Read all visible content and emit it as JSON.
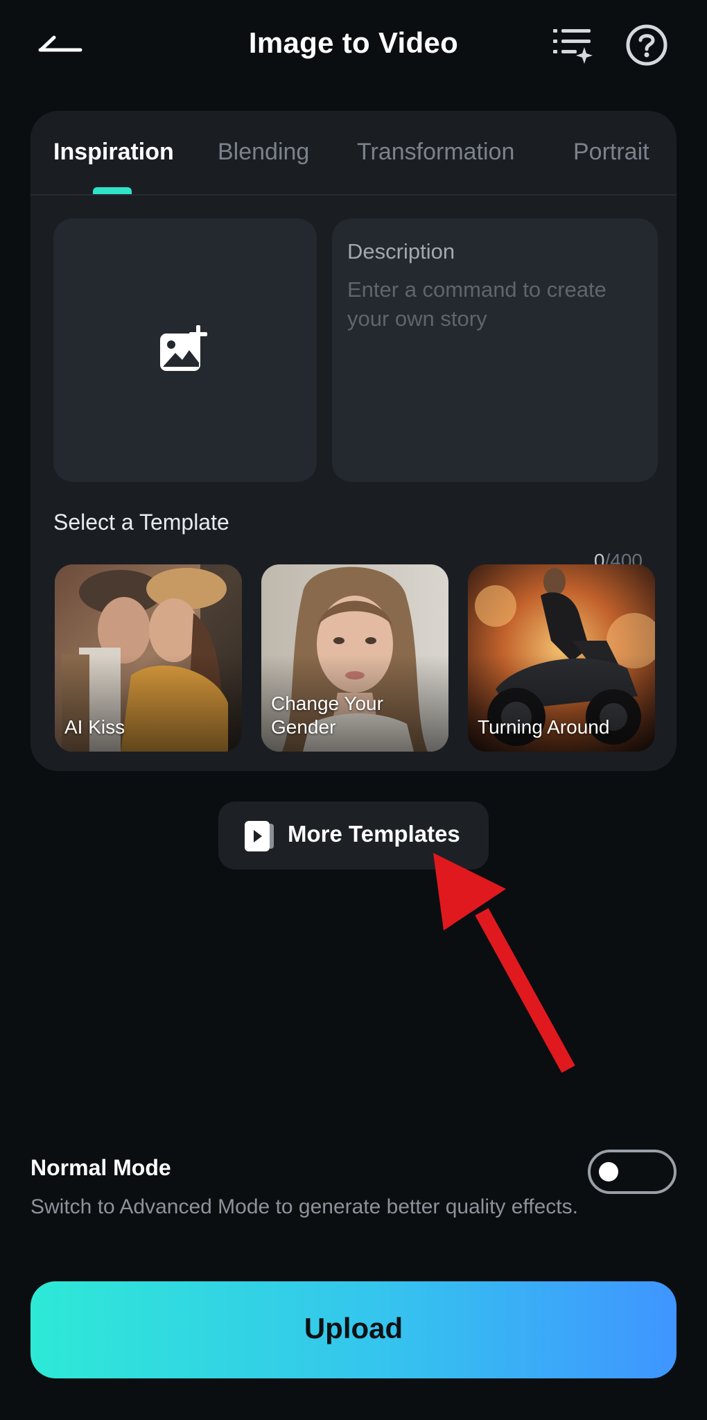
{
  "header": {
    "title": "Image to Video"
  },
  "tabs": [
    {
      "label": "Inspiration",
      "active": true
    },
    {
      "label": "Blending",
      "active": false
    },
    {
      "label": "Transformation",
      "active": false
    },
    {
      "label": "Portrait",
      "active": false
    }
  ],
  "description": {
    "label": "Description",
    "placeholder": "Enter a command to create your own story",
    "value": "",
    "count": "0",
    "max": "/400"
  },
  "templates": {
    "section_label": "Select a Template",
    "items": [
      {
        "label": "AI Kiss"
      },
      {
        "label": "Change Your Gender"
      },
      {
        "label": "Turning Around"
      }
    ]
  },
  "more_templates": {
    "label": "More Templates"
  },
  "mode": {
    "title": "Normal Mode",
    "description": "Switch to Advanced Mode to generate better quality effects.",
    "advanced_enabled": false
  },
  "upload": {
    "label": "Upload"
  },
  "colors": {
    "background": "#0b0e11",
    "card": "#1a1e23",
    "accent": "#2fe3c8",
    "button_gradient_start": "#2ee9d6",
    "button_gradient_end": "#3f95ff",
    "annotation_arrow": "#e0191e"
  },
  "icons": {
    "back": "back-arrow-icon",
    "history": "sparkle-list-icon",
    "help": "question-circle-icon",
    "add_image": "add-image-icon",
    "more_templates": "play-card-icon"
  }
}
